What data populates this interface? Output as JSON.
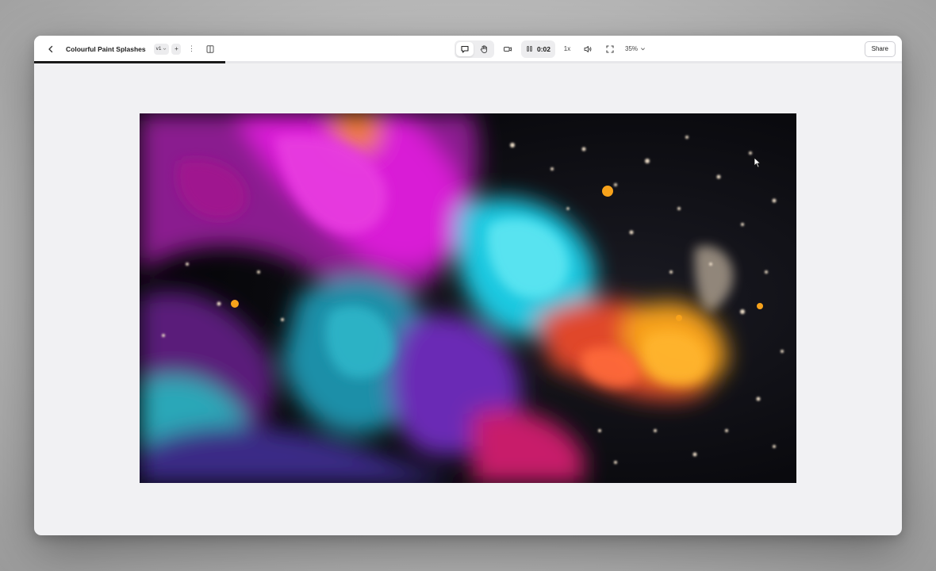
{
  "window": {
    "title": "Colourful Paint Splashes",
    "version": "v1",
    "add_label": "+",
    "more_label": "⋮"
  },
  "playback": {
    "time": "0:02",
    "speed": "1x",
    "zoom": "35%",
    "progress_fraction": 0.22
  },
  "toolbar": {
    "share_label": "Share",
    "icons": [
      "back-chevron-icon",
      "more-icon",
      "panel-icon",
      "comment-icon",
      "hand-icon",
      "camera-icon",
      "pause-icon",
      "volume-icon",
      "fullscreen-icon",
      "chevron-down-icon"
    ]
  },
  "colors": {
    "accent_dark": "#1a1a1a",
    "canvas_bg": "#f1f1f3",
    "magenta": "#d91ad6",
    "cyan": "#1fc8e0",
    "orange": "#f7a21b",
    "purple": "#6a2bb5"
  }
}
